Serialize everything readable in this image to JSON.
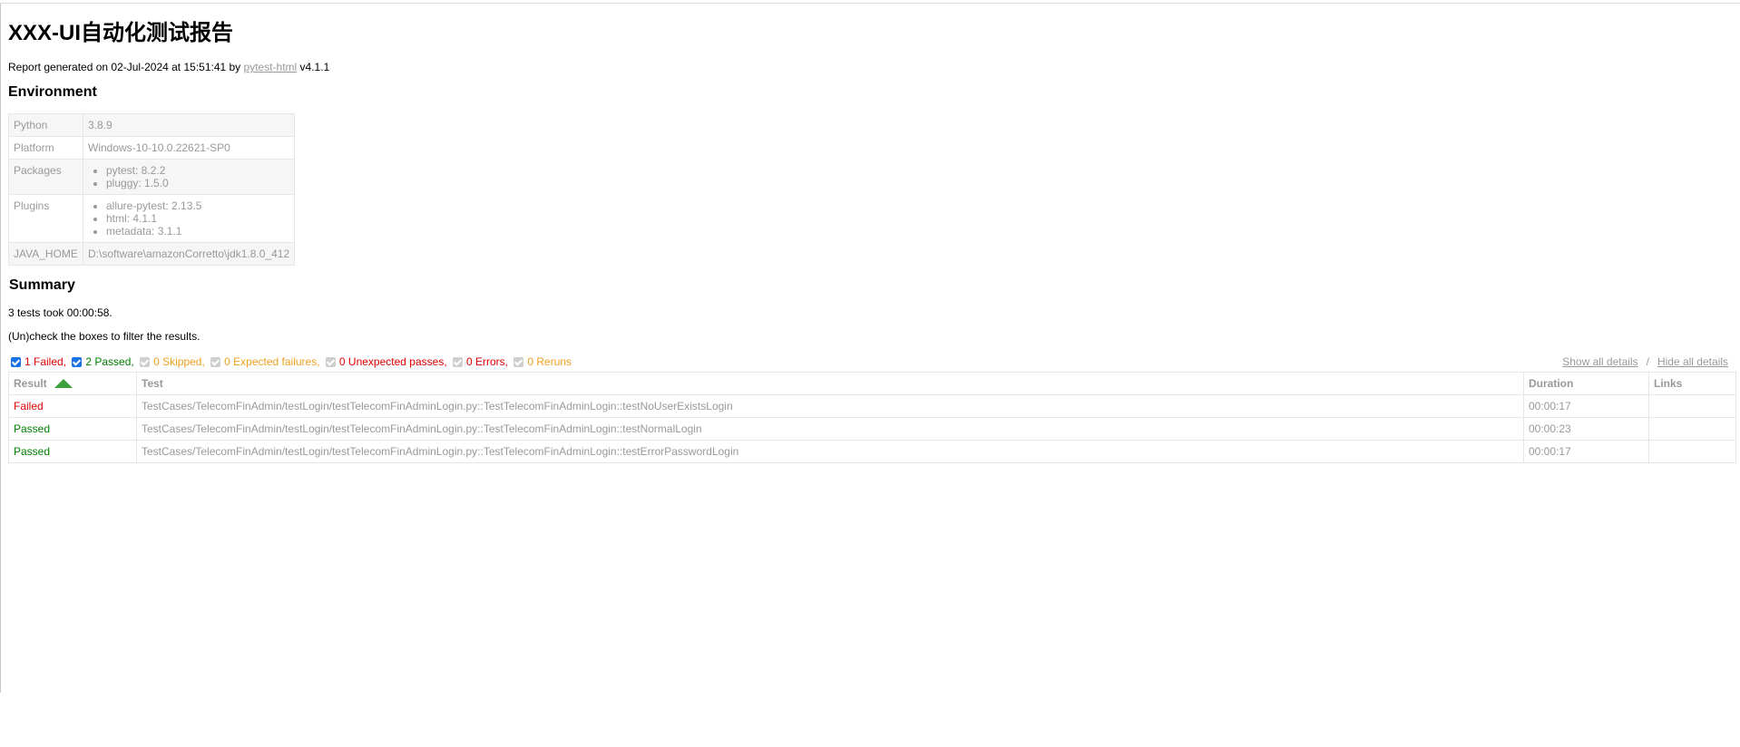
{
  "title": "XXX-UI自动化测试报告",
  "generated": {
    "prefix": "Report generated on 02-Jul-2024 at 15:51:41 by ",
    "link": "pytest-html",
    "suffix": " v4.1.1"
  },
  "environment": {
    "heading": "Environment",
    "python_key": "Python",
    "python_value": "3.8.9",
    "platform_key": "Platform",
    "platform_value": "Windows-10-10.0.22621-SP0",
    "packages_key": "Packages",
    "packages": [
      "pytest: 8.2.2",
      "pluggy: 1.5.0"
    ],
    "plugins_key": "Plugins",
    "plugins": [
      "allure-pytest: 2.13.5",
      "html: 4.1.1",
      "metadata: 3.1.1"
    ],
    "java_key": "JAVA_HOME",
    "java_value": "D:\\software\\amazonCorretto\\jdk1.8.0_412"
  },
  "summary": {
    "heading": "Summary",
    "took": "3 tests took 00:00:58.",
    "filter_hint": "(Un)check the boxes to filter the results."
  },
  "filters": [
    {
      "label": "1 Failed,",
      "checked": true,
      "color": "#dd0000"
    },
    {
      "label": "2 Passed,",
      "checked": true,
      "color": "#008000"
    },
    {
      "label": "0 Skipped,",
      "checked": false,
      "color": "#f0a020"
    },
    {
      "label": "0 Expected failures,",
      "checked": false,
      "color": "#f0a020"
    },
    {
      "label": "0 Unexpected passes,",
      "checked": false,
      "color": "#dd0000"
    },
    {
      "label": "0 Errors,",
      "checked": false,
      "color": "#dd0000"
    },
    {
      "label": "0 Reruns",
      "checked": false,
      "color": "#f0a020"
    }
  ],
  "details": {
    "show": "Show all details",
    "separator": "/",
    "hide": "Hide all details"
  },
  "results": {
    "headers": {
      "result": "Result",
      "test": "Test",
      "duration": "Duration",
      "links": "Links"
    },
    "rows": [
      {
        "result": "Failed",
        "test": "TestCases/TelecomFinAdmin/testLogin/testTelecomFinAdminLogin.py::TestTelecomFinAdminLogin::testNoUserExistsLogin",
        "duration": "00:00:17",
        "links": ""
      },
      {
        "result": "Passed",
        "test": "TestCases/TelecomFinAdmin/testLogin/testTelecomFinAdminLogin.py::TestTelecomFinAdminLogin::testNormalLogin",
        "duration": "00:00:23",
        "links": ""
      },
      {
        "result": "Passed",
        "test": "TestCases/TelecomFinAdmin/testLogin/testTelecomFinAdminLogin.py::TestTelecomFinAdminLogin::testErrorPasswordLogin",
        "duration": "00:00:17",
        "links": ""
      }
    ]
  },
  "colors": {
    "failed": "#dd0000",
    "passed": "#008000",
    "sort_arrow": "#3ca03c"
  }
}
